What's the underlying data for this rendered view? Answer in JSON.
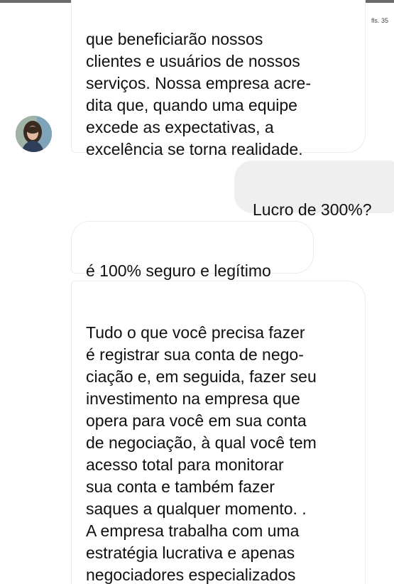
{
  "page_stamp": "fls. 35",
  "contact": {
    "avatar_icon": "profile-photo-woman-icon"
  },
  "messages": [
    {
      "side": "incoming",
      "text": "que beneficiarão nossos\nclientes e usuários de nossos\nserviços. Nossa empresa acre-\ndita que, quando uma equipe\nexcede as expectativas, a\nexcelência se torna realidade."
    },
    {
      "side": "outgoing",
      "text": "Lucro de 300%?"
    },
    {
      "side": "incoming",
      "text": "é 100% seguro e legítimo"
    },
    {
      "side": "incoming",
      "text": "Tudo o que você precisa fazer\né registrar sua conta de nego-\nciação e, em seguida, fazer seu\ninvestimento na empresa que\nopera para você em sua conta\nde negociação, à qual você tem\nacesso total para monitorar\nsua conta e também fazer\nsaques a qualquer momento.  .\nA empresa trabalha com uma\nestratégia lucrativa e apenas\nnegociadores especializados\noperam em sua conta para"
    }
  ],
  "colors": {
    "incoming_bubble": "#ffffff",
    "incoming_border": "#ececec",
    "outgoing_bubble": "#efefef",
    "text": "#111111"
  }
}
